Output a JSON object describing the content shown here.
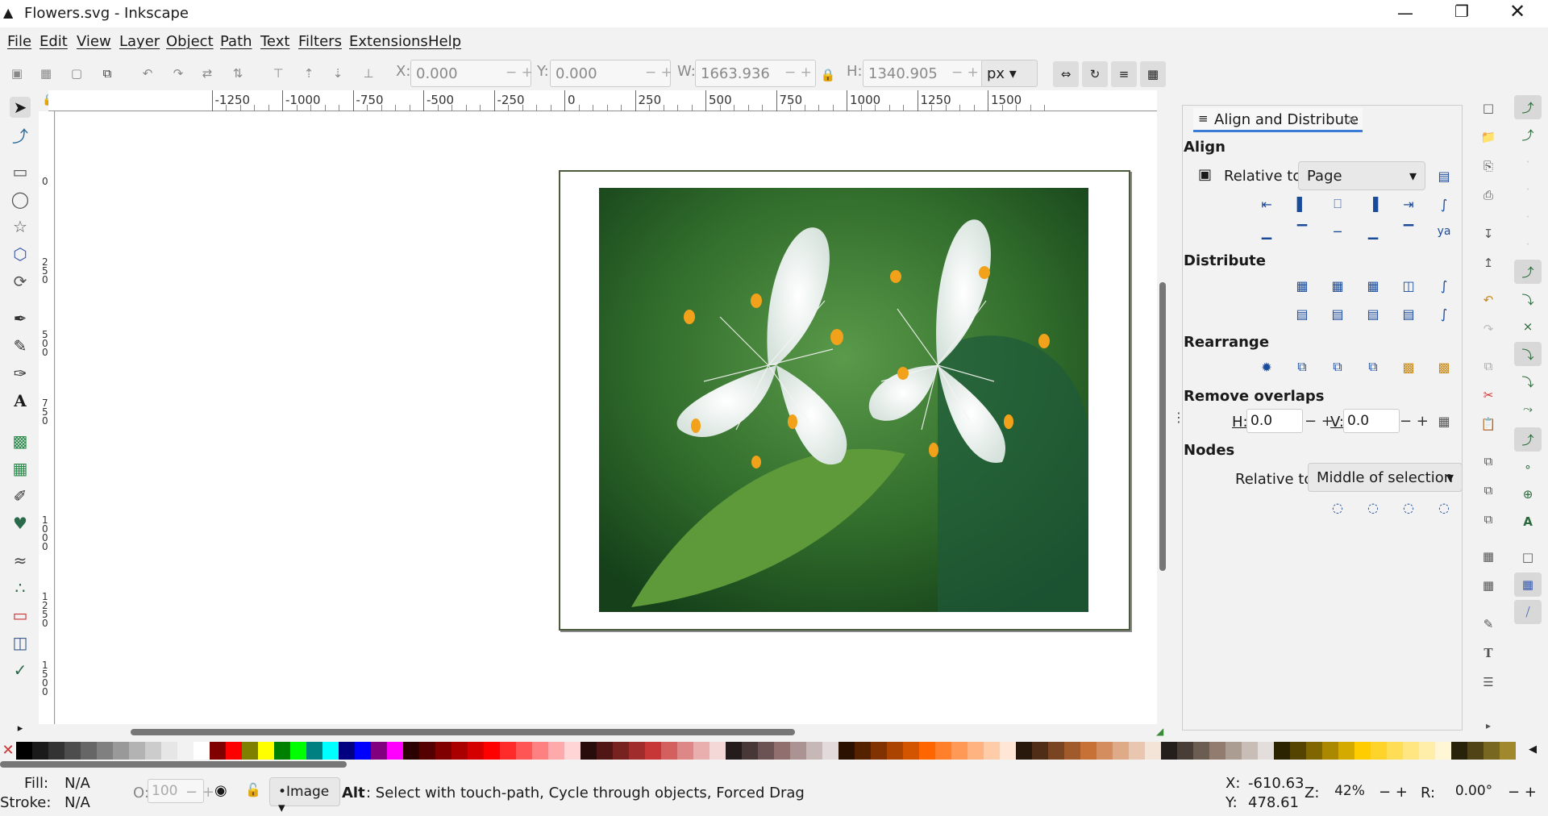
{
  "window": {
    "title": "Flowers.svg - Inkscape"
  },
  "menu": [
    "File",
    "Edit",
    "View",
    "Layer",
    "Object",
    "Path",
    "Text",
    "Filters",
    "Extensions",
    "Help"
  ],
  "toolbar": {
    "x_label": "X:",
    "x_value": "0.000",
    "y_label": "Y:",
    "y_value": "0.000",
    "w_label": "W:",
    "w_value": "1663.936",
    "h_label": "H:",
    "h_value": "1340.905",
    "unit": "px"
  },
  "ruler_h": [
    "-1250",
    "-1000",
    "-750",
    "-500",
    "-250",
    "0",
    "250",
    "500",
    "750",
    "1000",
    "1250",
    "1500"
  ],
  "ruler_v": [
    "0",
    "2\n5\n0",
    "5\n0\n0",
    "7\n5\n0",
    "1\n0\n0\n0",
    "1\n2\n5\n0",
    "1\n5\n0\n0"
  ],
  "dock": {
    "tab_label": "Align and Distribute",
    "align_header": "Align",
    "relative_to_label": "Relative to:",
    "relative_to_value": "Page",
    "distribute_header": "Distribute",
    "rearrange_header": "Rearrange",
    "remove_overlaps_header": "Remove overlaps",
    "h_label": "H:",
    "h_value": "0.0",
    "v_label": "V:",
    "v_value": "0.0",
    "nodes_header": "Nodes",
    "nodes_relative_label": "Relative to:",
    "nodes_relative_value": "Middle of selection"
  },
  "palette": [
    "#000000",
    "#1a1a1a",
    "#333333",
    "#4d4d4d",
    "#666666",
    "#808080",
    "#999999",
    "#b3b3b3",
    "#cccccc",
    "#e6e6e6",
    "#f2f2f2",
    "#ffffff",
    "#800000",
    "#ff0000",
    "#808000",
    "#ffff00",
    "#008000",
    "#00ff00",
    "#008080",
    "#00ffff",
    "#000080",
    "#0000ff",
    "#800080",
    "#ff00ff",
    "#2b0000",
    "#550000",
    "#800000",
    "#aa0000",
    "#d40000",
    "#ff0000",
    "#ff2a2a",
    "#ff5555",
    "#ff8080",
    "#ffaaaa",
    "#ffd5d5",
    "#280b0b",
    "#501616",
    "#782121",
    "#a02c2c",
    "#c83737",
    "#d35f5f",
    "#de8787",
    "#e9afaf",
    "#f4d7d7",
    "#241c1c",
    "#483737",
    "#6c5353",
    "#916f6f",
    "#ac9393",
    "#c8b7b7",
    "#e3dbdb",
    "#2b1100",
    "#552200",
    "#803300",
    "#aa4400",
    "#d45500",
    "#ff6600",
    "#ff7f2a",
    "#ff9955",
    "#ffb380",
    "#ffccaa",
    "#ffe6d5",
    "#28170b",
    "#502d16",
    "#784421",
    "#a05a2c",
    "#c87137",
    "#d38d5f",
    "#deaa87",
    "#e9c6af",
    "#f4e3d7",
    "#241f1c",
    "#483e37",
    "#6c5d53",
    "#917c6f",
    "#ac9d93",
    "#c8beb7",
    "#e3dedb",
    "#2b2200",
    "#554400",
    "#806600",
    "#aa8800",
    "#d4aa00",
    "#ffcc00",
    "#ffd42a",
    "#ffdd55",
    "#ffe680",
    "#ffeeaa",
    "#fff6d5",
    "#28220b",
    "#504416",
    "#786721",
    "#a0892c"
  ],
  "status": {
    "fill_label": "Fill:",
    "fill_value": "N/A",
    "stroke_label": "Stroke:",
    "stroke_value": "N/A",
    "opacity_label": "O:",
    "opacity_value": "100",
    "layer": "•Image",
    "message_key": "Alt",
    "message": ": Select with touch-path, Cycle through objects, Forced Drag",
    "x_label": "X:",
    "x_value": "-610.63",
    "y_label": "Y:",
    "y_value": "478.61",
    "zoom_label": "Z:",
    "zoom_value": "42%",
    "rot_label": "R:",
    "rot_value": "0.00°"
  }
}
